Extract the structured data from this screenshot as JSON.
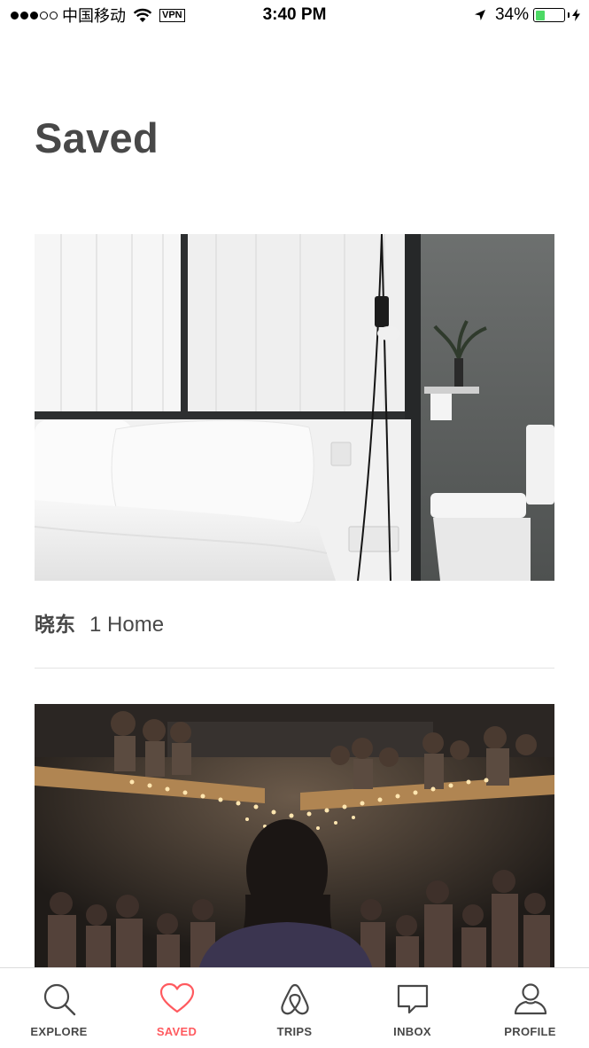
{
  "status_bar": {
    "carrier": "中国移动",
    "vpn": "VPN",
    "time": "3:40 PM",
    "battery_percent": "34%",
    "battery_level": 0.34,
    "signal_bars_filled": 3,
    "signal_bars_total": 5
  },
  "page": {
    "title": "Saved"
  },
  "wishlists": [
    {
      "name": "晓东",
      "count": "1 Home",
      "image_icon": "bedroom-photo"
    },
    {
      "name": "",
      "count": "",
      "image_icon": "event-audience-photo"
    }
  ],
  "tab_bar": {
    "tabs": [
      {
        "label": "EXPLORE",
        "icon": "search-icon",
        "active": false
      },
      {
        "label": "SAVED",
        "icon": "heart-icon",
        "active": true
      },
      {
        "label": "TRIPS",
        "icon": "airbnb-logo-icon",
        "active": false
      },
      {
        "label": "INBOX",
        "icon": "chat-bubble-icon",
        "active": false
      },
      {
        "label": "PROFILE",
        "icon": "user-icon",
        "active": false
      }
    ]
  },
  "colors": {
    "accent": "#ff5a5f",
    "text": "#484848",
    "battery": "#4cd964"
  }
}
